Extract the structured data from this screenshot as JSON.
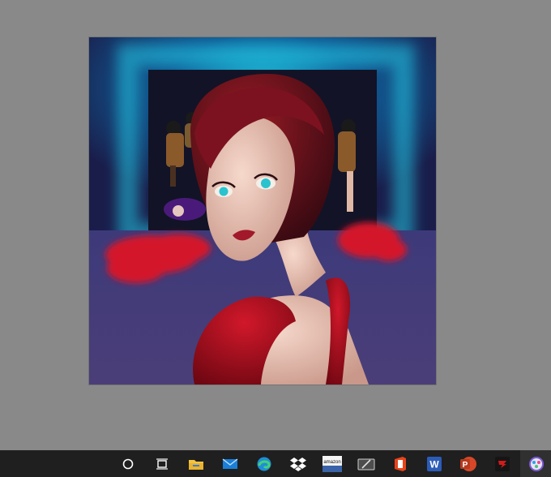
{
  "canvas": {
    "artwork_name": "digital-painting"
  },
  "taskbar": {
    "items": [
      {
        "name": "search-circle-icon"
      },
      {
        "name": "task-view-icon"
      },
      {
        "name": "file-explorer-icon"
      },
      {
        "name": "mail-icon"
      },
      {
        "name": "edge-icon"
      },
      {
        "name": "dropbox-icon"
      },
      {
        "name": "amazon-icon",
        "label": "amazon"
      },
      {
        "name": "sketch-tablet-icon"
      },
      {
        "name": "office-icon"
      },
      {
        "name": "word-icon",
        "label": "W"
      },
      {
        "name": "powerpoint-icon",
        "label": "P"
      },
      {
        "name": "red-app-icon"
      },
      {
        "name": "paint-app-icon"
      }
    ]
  },
  "colors": {
    "desktop": "#898989",
    "taskbar": "#1f1f1f",
    "accent_blue": "#1a88e0",
    "accent_red": "#c0122a"
  }
}
